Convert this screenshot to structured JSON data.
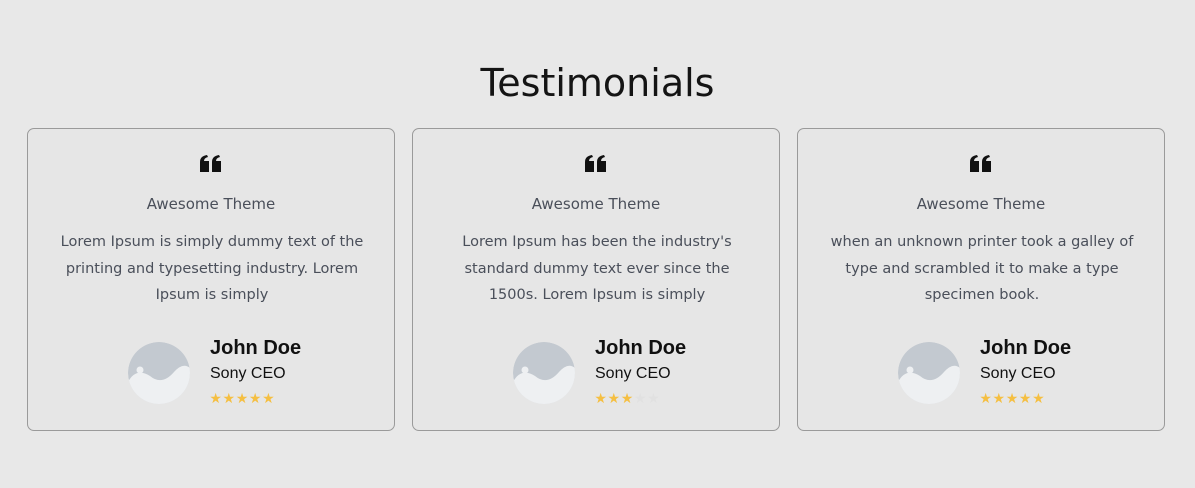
{
  "section": {
    "title": "Testimonials"
  },
  "navigation": {
    "prev_icon": "chevron-left-icon",
    "next_icon": "chevron-right-icon"
  },
  "colors": {
    "background": "#e8e8e8",
    "star_filled": "#f5bf42",
    "star_empty": "#e1e1e1",
    "card_border": "#9a9a9a"
  },
  "testimonials": [
    {
      "icon": "quote-icon",
      "theme": "Awesome Theme",
      "text": "Lorem Ipsum is simply dummy text of the printing and typesetting industry. Lorem Ipsum is simply",
      "name": "John Doe",
      "role": "Sony CEO",
      "rating": 5,
      "max_rating": 5
    },
    {
      "icon": "quote-icon",
      "theme": "Awesome Theme",
      "text": "Lorem Ipsum has been the industry's standard dummy text ever since the 1500s. Lorem Ipsum is simply",
      "name": "John Doe",
      "role": "Sony CEO",
      "rating": 3,
      "max_rating": 5
    },
    {
      "icon": "quote-icon",
      "theme": "Awesome Theme",
      "text": "when an unknown printer took a galley of type and scrambled it to make a type specimen book.",
      "name": "John Doe",
      "role": "Sony CEO",
      "rating": 5,
      "max_rating": 5
    }
  ]
}
